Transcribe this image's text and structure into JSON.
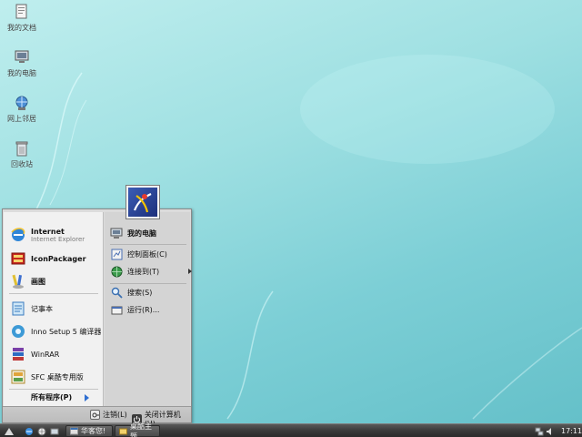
{
  "desktop": {
    "icons": [
      {
        "label": "我的文档",
        "icon": "my-documents-icon"
      },
      {
        "label": "我的电脑",
        "icon": "my-computer-icon"
      },
      {
        "label": "网上邻居",
        "icon": "network-places-icon"
      },
      {
        "label": "回收站",
        "icon": "recycle-bin-icon"
      }
    ]
  },
  "start_menu": {
    "pinned": [
      {
        "title": "Internet",
        "subtitle": "Internet Explorer",
        "icon": "internet-explorer-icon"
      },
      {
        "title": "IconPackager",
        "icon": "iconpackager-icon"
      },
      {
        "title": "画图",
        "icon": "paint-icon"
      }
    ],
    "recent": [
      {
        "title": "记事本",
        "icon": "notepad-icon"
      },
      {
        "title": "Inno Setup 5 编译器",
        "icon": "inno-setup-icon"
      },
      {
        "title": "WinRAR",
        "icon": "winrar-icon"
      },
      {
        "title": "SFC 桌酷专用版",
        "icon": "sfc-icon"
      }
    ],
    "all_programs": "所有程序(P)",
    "right": {
      "my_computer": "我的电脑",
      "control_panel": "控制面板(C)",
      "connect_to": "连接到(T)",
      "search": "搜索(S)",
      "run": "运行(R)..."
    },
    "logoff": "注销(L)",
    "shutdown": "关闭计算机(U)"
  },
  "taskbar": {
    "tasks": [
      {
        "label": "华客您!"
      },
      {
        "label": "桌酷主题..."
      }
    ],
    "clock": "17:11"
  },
  "colors": {
    "desktop_bg": "#9fe0e2",
    "start_menu_left": "#f1f1f1",
    "start_menu_right": "#d4d4d4",
    "taskbar": "#3a3a3a",
    "accent": "#2f6fd1"
  }
}
